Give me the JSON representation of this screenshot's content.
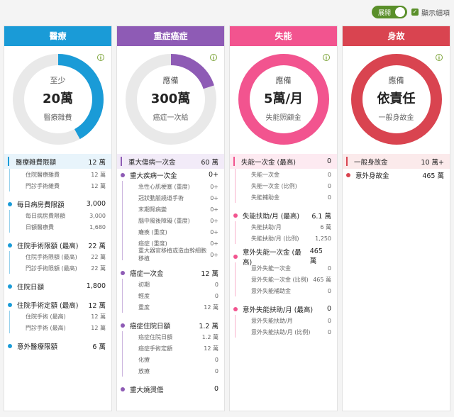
{
  "topbar": {
    "toggle_label": "展開",
    "checkbox_label": "顯示細項"
  },
  "columns": [
    {
      "id": "medical",
      "title": "醫療",
      "color": "#1a9bd7",
      "light": "#e8f4fb",
      "track": "#e9e9e9",
      "fraction": 0.42,
      "ring": {
        "l1": "至少",
        "l2": "20萬",
        "l3": "醫療雜費"
      },
      "rows": [
        {
          "kind": "hl",
          "label": "醫療雜費限額",
          "value": "12 萬"
        },
        {
          "kind": "sub",
          "label": "住院醫療雜費",
          "value": "12 萬"
        },
        {
          "kind": "sub",
          "label": "門診手術雜費",
          "value": "12 萬"
        },
        {
          "kind": "gap"
        },
        {
          "kind": "main",
          "label": "每日病房費限額",
          "value": "3,000"
        },
        {
          "kind": "sub",
          "label": "每日病房費限額",
          "value": "3,000"
        },
        {
          "kind": "sub",
          "label": "日額醫療費",
          "value": "1,680"
        },
        {
          "kind": "gap"
        },
        {
          "kind": "main",
          "label": "住院手術限額 (最高)",
          "value": "22 萬"
        },
        {
          "kind": "sub",
          "label": "住院手術限額 (最高)",
          "value": "22 萬"
        },
        {
          "kind": "sub",
          "label": "門診手術限額 (最高)",
          "value": "22 萬"
        },
        {
          "kind": "gap"
        },
        {
          "kind": "main",
          "label": "住院日額",
          "value": "1,800"
        },
        {
          "kind": "gap"
        },
        {
          "kind": "main",
          "label": "住院手術定額 (最高)",
          "value": "12 萬"
        },
        {
          "kind": "sub",
          "label": "住院手術 (最高)",
          "value": "12 萬"
        },
        {
          "kind": "sub",
          "label": "門診手術 (最高)",
          "value": "12 萬"
        },
        {
          "kind": "gap"
        },
        {
          "kind": "main",
          "label": "意外醫療限額",
          "value": "6 萬"
        }
      ]
    },
    {
      "id": "critical",
      "title": "重症癌症",
      "color": "#8e5bb5",
      "light": "#f2ebf8",
      "track": "#e9e9e9",
      "fraction": 0.2,
      "ring": {
        "l1": "應備",
        "l2": "300萬",
        "l3": "癌症一次給"
      },
      "rows": [
        {
          "kind": "hl",
          "label": "重大傷病一次金",
          "value": "60 萬"
        },
        {
          "kind": "main",
          "label": "重大疾病一次金",
          "value": "0+"
        },
        {
          "kind": "sub",
          "label": "急性心肌梗塞 (重度)",
          "value": "0+"
        },
        {
          "kind": "sub",
          "label": "冠狀動脈繞道手術",
          "value": "0+"
        },
        {
          "kind": "sub",
          "label": "末期腎病變",
          "value": "0+"
        },
        {
          "kind": "sub",
          "label": "腦中風後障礙 (重度)",
          "value": "0+"
        },
        {
          "kind": "sub",
          "label": "癱瘓 (重度)",
          "value": "0+"
        },
        {
          "kind": "sub",
          "label": "癌症 (重度)",
          "value": "0+"
        },
        {
          "kind": "sub",
          "label": "重大器官移植或造血幹細胞移植",
          "value": "0+"
        },
        {
          "kind": "gap"
        },
        {
          "kind": "main",
          "label": "癌症一次金",
          "value": "12 萬"
        },
        {
          "kind": "sub",
          "label": "初期",
          "value": "0"
        },
        {
          "kind": "sub",
          "label": "輕度",
          "value": "0"
        },
        {
          "kind": "sub",
          "label": "重度",
          "value": "12 萬"
        },
        {
          "kind": "gap"
        },
        {
          "kind": "main",
          "label": "癌症住院日額",
          "value": "1.2 萬"
        },
        {
          "kind": "sub",
          "label": "癌症住院日額",
          "value": "1.2 萬"
        },
        {
          "kind": "sub",
          "label": "癌症手術定額",
          "value": "12 萬"
        },
        {
          "kind": "sub",
          "label": "化療",
          "value": "0"
        },
        {
          "kind": "sub",
          "label": "放療",
          "value": "0"
        },
        {
          "kind": "gap"
        },
        {
          "kind": "main",
          "label": "重大燒燙傷",
          "value": "0"
        }
      ]
    },
    {
      "id": "disability",
      "title": "失能",
      "color": "#f2548f",
      "light": "#fdeaf1",
      "track": "#f2548f",
      "fraction": 1.0,
      "ring": {
        "l1": "應備",
        "l2": "5萬/月",
        "l3": "失能照顧金"
      },
      "rows": [
        {
          "kind": "hl",
          "label": "失能一次金 (最高)",
          "value": "0"
        },
        {
          "kind": "sub",
          "label": "失能一次金",
          "value": "0"
        },
        {
          "kind": "sub",
          "label": "失能一次金 (比例)",
          "value": "0"
        },
        {
          "kind": "sub",
          "label": "失能補助金",
          "value": "0"
        },
        {
          "kind": "gap"
        },
        {
          "kind": "main",
          "label": "失能扶助/月 (最高)",
          "value": "6.1 萬"
        },
        {
          "kind": "sub",
          "label": "失能扶助/月",
          "value": "6 萬"
        },
        {
          "kind": "sub",
          "label": "失能扶助/月 (比例)",
          "value": "1,250"
        },
        {
          "kind": "gap"
        },
        {
          "kind": "main",
          "label": "意外失能一次金 (最高)",
          "value": "465 萬"
        },
        {
          "kind": "sub",
          "label": "意外失能一次金",
          "value": "0"
        },
        {
          "kind": "sub",
          "label": "意外失能一次金 (比例)",
          "value": "465 萬"
        },
        {
          "kind": "sub",
          "label": "意外失能補助金",
          "value": "0"
        },
        {
          "kind": "gap"
        },
        {
          "kind": "main",
          "label": "意外失能扶助/月 (最高)",
          "value": "0"
        },
        {
          "kind": "sub",
          "label": "意外失能扶助/月",
          "value": "0"
        },
        {
          "kind": "sub",
          "label": "意外失能扶助/月 (比例)",
          "value": "0"
        }
      ]
    },
    {
      "id": "death",
      "title": "身故",
      "color": "#d94450",
      "light": "#fbeaeb",
      "track": "#d94450",
      "fraction": 1.0,
      "ring": {
        "l1": "應備",
        "l2": "依責任",
        "l3": "一般身故金"
      },
      "rows": [
        {
          "kind": "hl",
          "label": "一般身故金",
          "value": "10 萬+"
        },
        {
          "kind": "main",
          "label": "意外身故金",
          "value": "465 萬"
        }
      ]
    }
  ]
}
